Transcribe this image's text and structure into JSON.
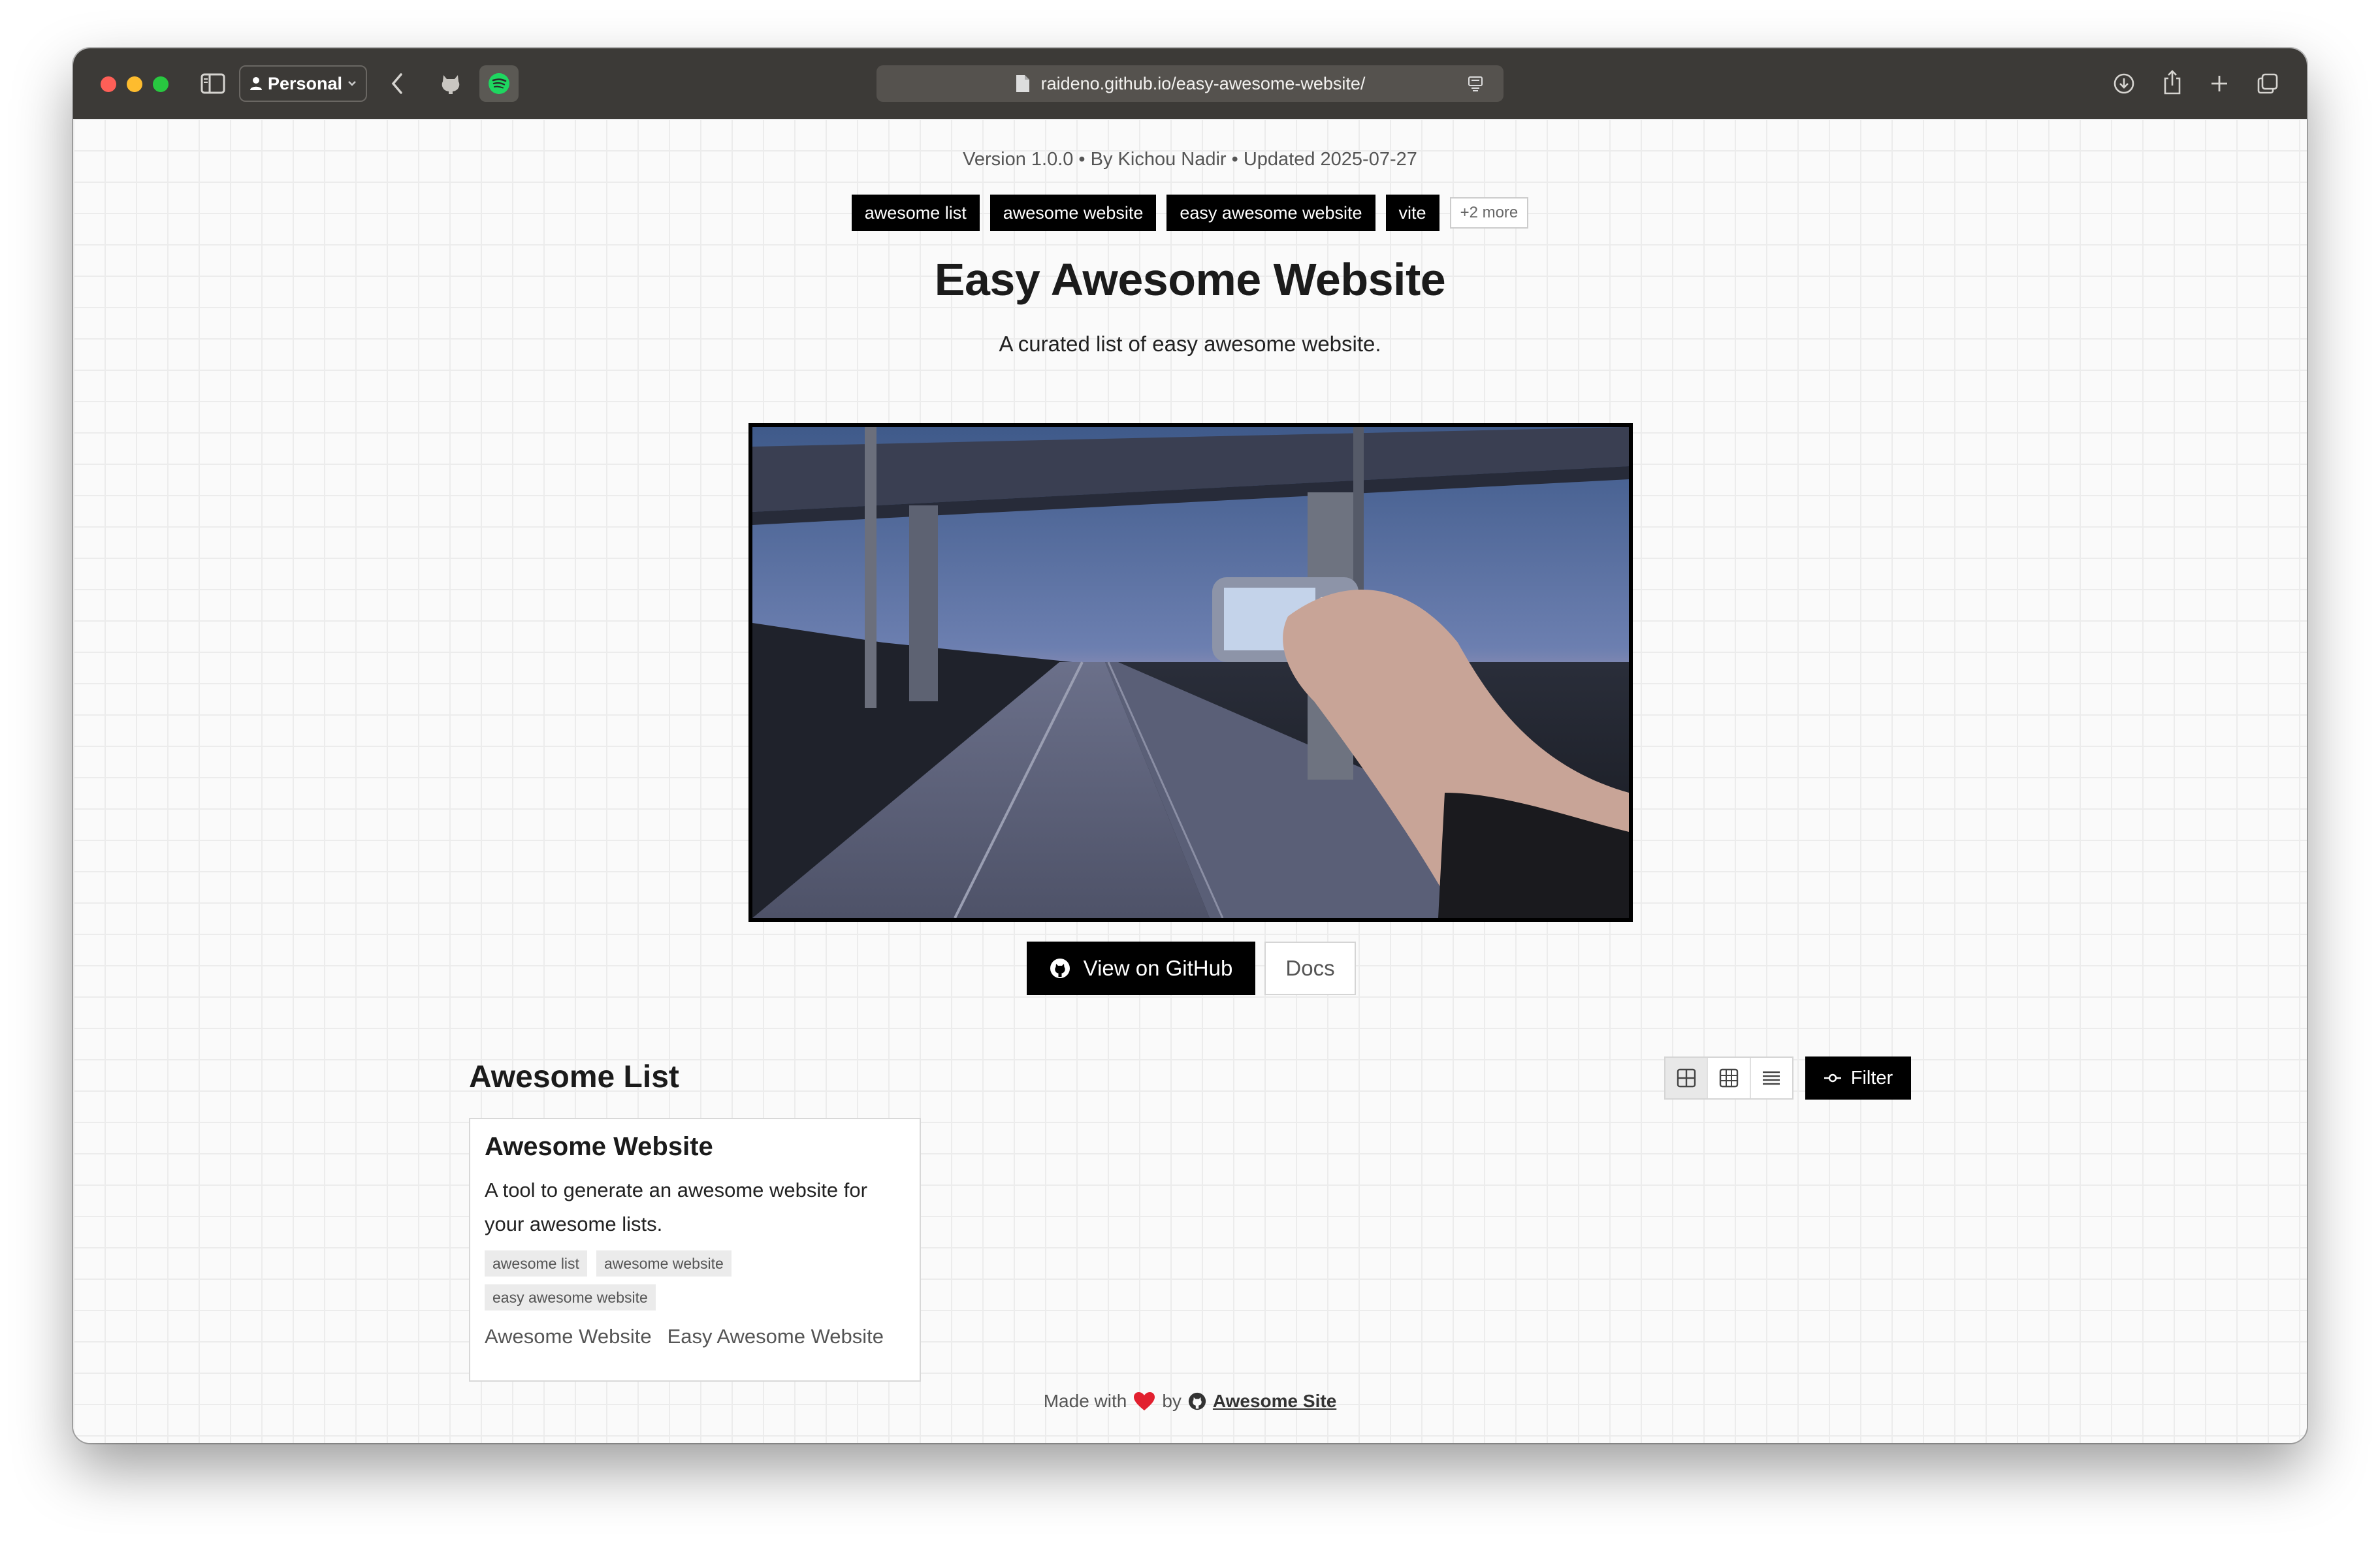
{
  "browser": {
    "profile_label": "Personal",
    "url": "raideno.github.io/easy-awesome-website/",
    "icons": [
      "sidebar-icon",
      "back-icon",
      "github-extension-icon",
      "spotify-icon",
      "download-icon",
      "share-icon",
      "new-tab-icon",
      "tabs-overview-icon"
    ]
  },
  "header": {
    "meta": "Version 1.0.0 • By Kichou Nadir • Updated 2025-07-27",
    "tags": [
      "awesome list",
      "awesome website",
      "easy awesome website",
      "vite"
    ],
    "more_tags": "+2 more",
    "title": "Easy Awesome Website",
    "subtitle": "A curated list of easy awesome website."
  },
  "actions": {
    "github_label": "View on GitHub",
    "docs_label": "Docs"
  },
  "list": {
    "title": "Awesome List",
    "filter_label": "Filter",
    "view_modes": [
      "large-grid",
      "grid",
      "list"
    ],
    "active_view": "large-grid",
    "items": [
      {
        "title": "Awesome Website",
        "description": "A tool to generate an awesome website for your awesome lists.",
        "tags": [
          "awesome list",
          "awesome website",
          "easy awesome website"
        ],
        "links": [
          "Awesome Website",
          "Easy Awesome Website"
        ]
      }
    ]
  },
  "footer": {
    "made_with": "Made with",
    "by": "by",
    "site": "Awesome Site"
  },
  "colors": {
    "titlebar": "#3c3a37",
    "accent": "#000000",
    "page_bg": "#fafafa"
  }
}
